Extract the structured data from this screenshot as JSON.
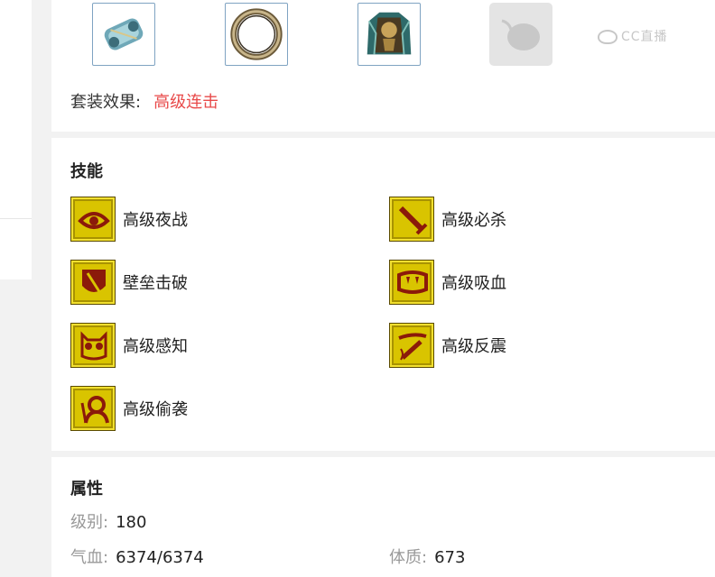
{
  "equipment": {
    "slots": [
      {
        "icon": "bracer-icon"
      },
      {
        "icon": "ring-icon"
      },
      {
        "icon": "armor-icon"
      },
      {
        "icon": "empty-slot-icon"
      }
    ],
    "watermark": "CC直播",
    "set_effect_label": "套装效果:",
    "set_effect_value": "高级连击"
  },
  "skills": {
    "title": "技能",
    "items": [
      {
        "name": "高级夜战",
        "icon": "eye-icon"
      },
      {
        "name": "高级必杀",
        "icon": "sword-icon"
      },
      {
        "name": "壁垒击破",
        "icon": "shield-break-icon"
      },
      {
        "name": "高级吸血",
        "icon": "fang-icon"
      },
      {
        "name": "高级感知",
        "icon": "owl-icon"
      },
      {
        "name": "高级反震",
        "icon": "counter-icon"
      },
      {
        "name": "高级偷袭",
        "icon": "ambush-icon"
      }
    ]
  },
  "attributes": {
    "title": "属性",
    "level_label": "级别:",
    "level_value": "180",
    "hp_label": "气血:",
    "hp_value": "6374/6374",
    "con_label": "体质:",
    "con_value": "673"
  },
  "colors": {
    "accent_red": "#e84a4a",
    "skill_gold": "#d9c400",
    "skill_glyph": "#8b1a0a"
  }
}
